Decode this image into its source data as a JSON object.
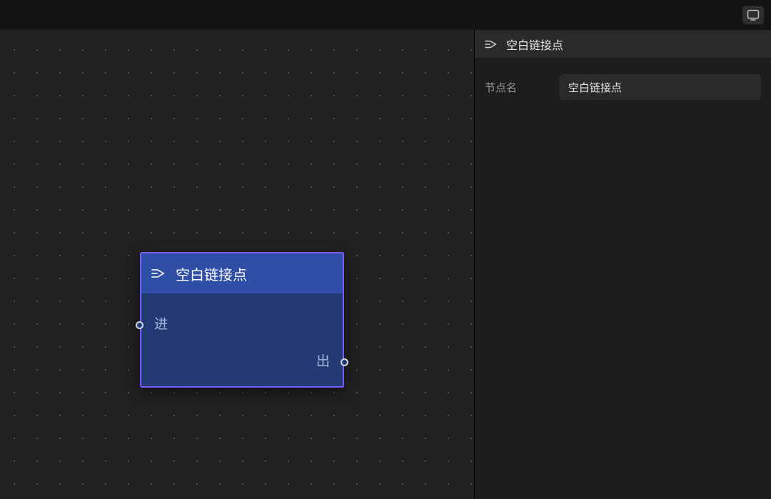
{
  "topbar": {
    "cast_icon": "cast-icon"
  },
  "node": {
    "title": "空白链接点",
    "ports": {
      "in_label": "进",
      "out_label": "出"
    }
  },
  "sidebar": {
    "header_title": "空白链接点",
    "node_name_label": "节点名",
    "node_name_value": "空白链接点"
  },
  "colors": {
    "accent": "#7d5cff",
    "node_header": "#2f4ea6",
    "node_body": "#233a74",
    "canvas": "#212121",
    "panel": "#1d1d1d"
  }
}
